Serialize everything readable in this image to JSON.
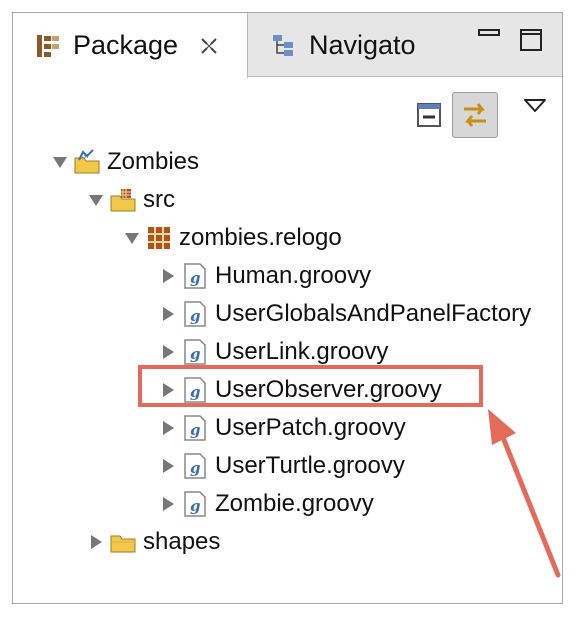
{
  "tabs": [
    {
      "label": "Package",
      "active": true
    },
    {
      "label": "Navigato",
      "active": false
    }
  ],
  "tree": [
    {
      "label": "Zombies",
      "depth": 0,
      "expanded": true,
      "icon": "groovy-project-icon"
    },
    {
      "label": "src",
      "depth": 1,
      "expanded": true,
      "icon": "source-folder-icon"
    },
    {
      "label": "zombies.relogo",
      "depth": 2,
      "expanded": true,
      "icon": "package-icon"
    },
    {
      "label": "Human.groovy",
      "depth": 3,
      "expanded": false,
      "icon": "groovy-file-icon"
    },
    {
      "label": "UserGlobalsAndPanelFactory",
      "depth": 3,
      "expanded": false,
      "icon": "groovy-file-icon"
    },
    {
      "label": "UserLink.groovy",
      "depth": 3,
      "expanded": false,
      "icon": "groovy-file-icon"
    },
    {
      "label": "UserObserver.groovy",
      "depth": 3,
      "expanded": false,
      "icon": "groovy-file-icon",
      "highlighted": true
    },
    {
      "label": "UserPatch.groovy",
      "depth": 3,
      "expanded": false,
      "icon": "groovy-file-icon"
    },
    {
      "label": "UserTurtle.groovy",
      "depth": 3,
      "expanded": false,
      "icon": "groovy-file-icon"
    },
    {
      "label": "Zombie.groovy",
      "depth": 3,
      "expanded": false,
      "icon": "groovy-file-icon"
    },
    {
      "label": "shapes",
      "depth": 1,
      "expanded": false,
      "icon": "folder-icon"
    }
  ],
  "colors": {
    "highlight": "#e46a5a",
    "folder": "#f2c84b",
    "package": "#b0541c",
    "groovy": "#3b6fb6"
  }
}
